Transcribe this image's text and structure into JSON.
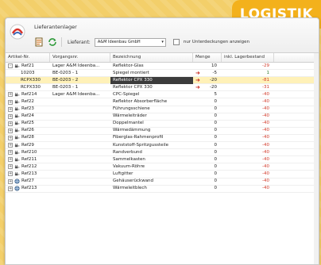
{
  "badge": "LOGISTIK",
  "window": {
    "title": "Lieferantenlager",
    "toolbar": {
      "supplier_label": "Lieferant:",
      "supplier_value": "A&M Ideenbau GmbH",
      "checkbox_label": "nur Unterdeckungen anzeigen"
    }
  },
  "columns": [
    "Artikel-Nr.",
    "Vorgangsnr.",
    "Bezeichnung",
    "Menge",
    "inkl. Lagerbestand"
  ],
  "rows": [
    {
      "art": "Ref21",
      "vorg": "Lager A&M Ideenba...",
      "bez": "Reflektor-Glas",
      "menge": "10",
      "lager": "-29",
      "tog": "-",
      "arrow": false,
      "style": "",
      "icon": "plug"
    },
    {
      "art": "10203",
      "vorg": "BE-0203 - 1",
      "bez": "Spiegel montiert",
      "menge": "-5",
      "lager": "1",
      "tog": "",
      "arrow": true,
      "style": "",
      "icon": ""
    },
    {
      "art": "RCPX330",
      "vorg": "BE-0203 - 2",
      "bez": "Reflektor CPX 330",
      "menge": "-20",
      "lager": "-81",
      "tog": "",
      "arrow": true,
      "style": "sel sel-dark",
      "icon": ""
    },
    {
      "art": "RCPX330",
      "vorg": "BE-0203 - 1",
      "bez": "Reflektor CPX 330",
      "menge": "-20",
      "lager": "-31",
      "tog": "",
      "arrow": true,
      "style": "",
      "icon": ""
    },
    {
      "art": "Ref214",
      "vorg": "Lager A&M Ideenba...",
      "bez": "CPC-Spiegel",
      "menge": "5",
      "lager": "-40",
      "tog": "+",
      "arrow": false,
      "style": "",
      "icon": "plug"
    },
    {
      "art": "Ref22",
      "vorg": "",
      "bez": "Reflektor Absorberfläche",
      "menge": "0",
      "lager": "-40",
      "tog": "+",
      "arrow": false,
      "style": "",
      "icon": "plug"
    },
    {
      "art": "Ref23",
      "vorg": "",
      "bez": "Führungsschiene",
      "menge": "0",
      "lager": "-40",
      "tog": "+",
      "arrow": false,
      "style": "",
      "icon": "plug"
    },
    {
      "art": "Ref24",
      "vorg": "",
      "bez": "Wärmeleiträder",
      "menge": "0",
      "lager": "-40",
      "tog": "+",
      "arrow": false,
      "style": "",
      "icon": "plug"
    },
    {
      "art": "Ref25",
      "vorg": "",
      "bez": "Doppelmantel",
      "menge": "0",
      "lager": "-40",
      "tog": "+",
      "arrow": false,
      "style": "",
      "icon": "plug"
    },
    {
      "art": "Ref26",
      "vorg": "",
      "bez": "Wärmedämmung",
      "menge": "0",
      "lager": "-40",
      "tog": "+",
      "arrow": false,
      "style": "",
      "icon": "plug"
    },
    {
      "art": "Ref28",
      "vorg": "",
      "bez": "Fiberglas-Rahmenprofil",
      "menge": "0",
      "lager": "-40",
      "tog": "+",
      "arrow": false,
      "style": "",
      "icon": "plug"
    },
    {
      "art": "Ref29",
      "vorg": "",
      "bez": "Kunststoff-Spritzgussteile",
      "menge": "0",
      "lager": "-40",
      "tog": "+",
      "arrow": false,
      "style": "",
      "icon": "plug"
    },
    {
      "art": "Ref210",
      "vorg": "",
      "bez": "Randverbund",
      "menge": "0",
      "lager": "-40",
      "tog": "+",
      "arrow": false,
      "style": "",
      "icon": "plug"
    },
    {
      "art": "Ref211",
      "vorg": "",
      "bez": "Sammelkasten",
      "menge": "0",
      "lager": "-40",
      "tog": "+",
      "arrow": false,
      "style": "",
      "icon": "plug"
    },
    {
      "art": "Ref212",
      "vorg": "",
      "bez": "Vakuum-Röhre",
      "menge": "0",
      "lager": "-40",
      "tog": "+",
      "arrow": false,
      "style": "",
      "icon": "plug"
    },
    {
      "art": "Ref213",
      "vorg": "",
      "bez": "Luftgitter",
      "menge": "0",
      "lager": "-40",
      "tog": "+",
      "arrow": false,
      "style": "",
      "icon": "plug"
    },
    {
      "art": "Ref27",
      "vorg": "",
      "bez": "Gehäuserückwand",
      "menge": "0",
      "lager": "-40",
      "tog": "+",
      "arrow": false,
      "style": "",
      "icon": "globe"
    },
    {
      "art": "Ref213",
      "vorg": "",
      "bez": "Wärmeleitblech",
      "menge": "0",
      "lager": "-40",
      "tog": "+",
      "arrow": false,
      "style": "",
      "icon": "globe"
    }
  ]
}
